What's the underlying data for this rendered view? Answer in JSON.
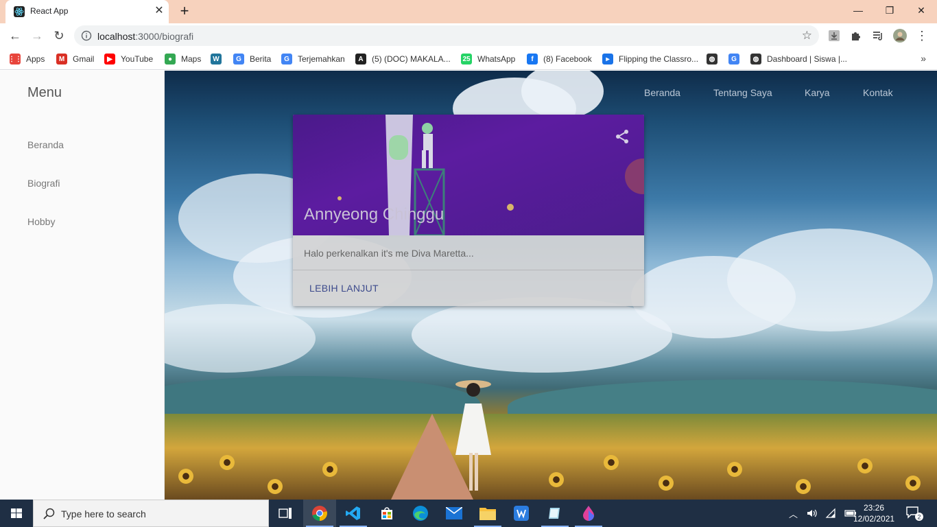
{
  "browser": {
    "tab_title": "React App",
    "url_host": "localhost",
    "url_path": ":3000/biografi"
  },
  "bookmarks": [
    {
      "label": "Apps",
      "icon": "apps-grid-icon",
      "color": "#e8453c"
    },
    {
      "label": "Gmail",
      "icon": "gmail-icon",
      "color": "#d93025"
    },
    {
      "label": "YouTube",
      "icon": "youtube-icon",
      "color": "#ff0000"
    },
    {
      "label": "Maps",
      "icon": "maps-icon",
      "color": "#34a853"
    },
    {
      "label": "",
      "icon": "wordpress-icon",
      "color": "#21759b"
    },
    {
      "label": "Berita",
      "icon": "google-news-icon",
      "color": "#4285f4"
    },
    {
      "label": "Terjemahkan",
      "icon": "google-translate-icon",
      "color": "#4285f4"
    },
    {
      "label": "(5) (DOC) MAKALA...",
      "icon": "academia-icon",
      "color": "#222222"
    },
    {
      "label": "WhatsApp",
      "icon": "whatsapp-icon",
      "color": "#25d366"
    },
    {
      "label": "(8) Facebook",
      "icon": "facebook-icon",
      "color": "#1877f2"
    },
    {
      "label": "Flipping the Classro...",
      "icon": "flipping-icon",
      "color": "#1a73e8"
    },
    {
      "label": "",
      "icon": "globe-icon",
      "color": "#333333"
    },
    {
      "label": "",
      "icon": "google-icon",
      "color": "#4285f4"
    },
    {
      "label": "Dashboard | Siswa |...",
      "icon": "globe-icon",
      "color": "#333333"
    }
  ],
  "sidebar": {
    "title": "Menu",
    "items": [
      {
        "label": "Beranda"
      },
      {
        "label": "Biografi"
      },
      {
        "label": "Hobby"
      }
    ]
  },
  "topnav": {
    "items": [
      {
        "label": "Beranda"
      },
      {
        "label": "Tentang Saya"
      },
      {
        "label": "Karya"
      },
      {
        "label": "Kontak"
      }
    ]
  },
  "card": {
    "title": "Annyeong Chinggu",
    "body": "Halo perkenalkan it's me Diva Maretta...",
    "action": "LEBIH LANJUT"
  },
  "taskbar": {
    "search_placeholder": "Type here to search",
    "time": "23:26",
    "date": "12/02/2021",
    "notification_count": "2"
  },
  "colors": {
    "tab_strip": "#f7d2bd",
    "card_media": "#5c1ca0",
    "action_text": "#3c4a8c",
    "taskbar": "#1f2f44"
  }
}
